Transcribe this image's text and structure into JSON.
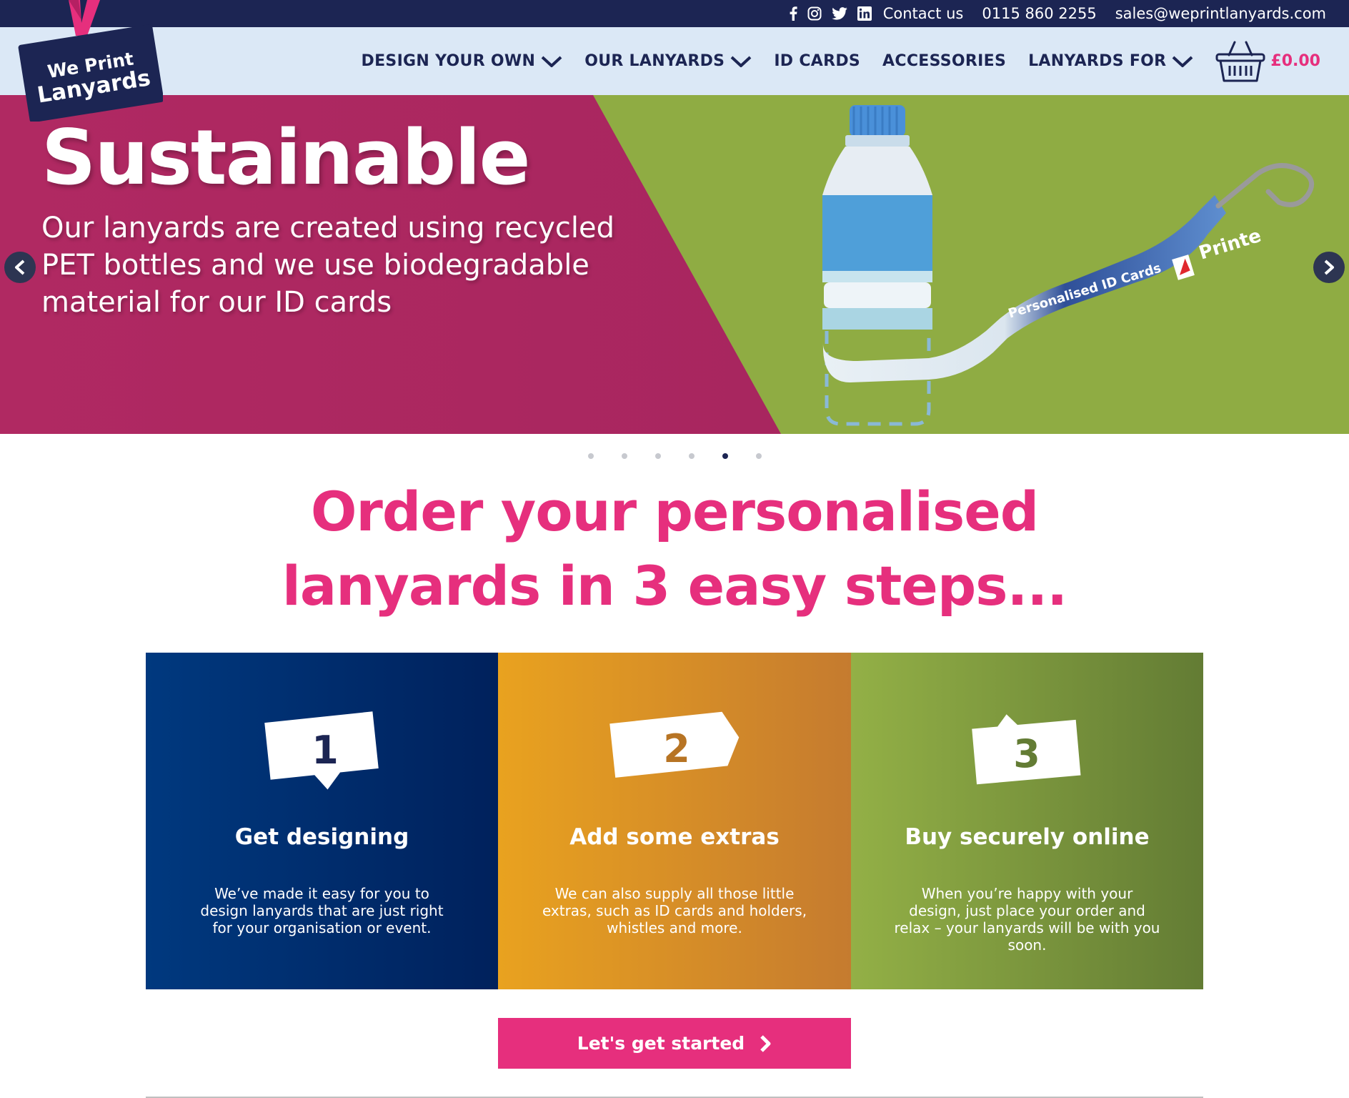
{
  "topbar": {
    "social": [
      "facebook-icon",
      "instagram-icon",
      "twitter-icon",
      "linkedin-icon"
    ],
    "contact_label": "Contact us",
    "phone": "0115 860 2255",
    "email": "sales@weprintlanyards.com"
  },
  "logo": {
    "line1": "We Print",
    "line2": "Lanyards"
  },
  "nav": {
    "items": [
      {
        "label": "DESIGN YOUR OWN",
        "dropdown": true
      },
      {
        "label": "OUR LANYARDS",
        "dropdown": true
      },
      {
        "label": "ID CARDS",
        "dropdown": false
      },
      {
        "label": "ACCESSORIES",
        "dropdown": false
      },
      {
        "label": "LANYARDS FOR",
        "dropdown": true
      }
    ],
    "basket_total": "£0.00"
  },
  "hero": {
    "title": "Sustainable",
    "subtitle": "Our lanyards are created using recycled PET bottles and we use biodegradable material for our ID cards",
    "lanyard_text_1": "Personalised ID Cards",
    "lanyard_text_2": "Printe",
    "slide_count": 6,
    "active_slide": 5
  },
  "heading": {
    "line1": "Order your personalised",
    "line2": "lanyards in 3 easy steps..."
  },
  "steps": [
    {
      "number": "1",
      "title": "Get designing",
      "text": "We’ve made it easy for you to design lanyards that are just right for your organisation or event."
    },
    {
      "number": "2",
      "title": "Add some extras",
      "text": "We can also supply all those little extras, such as ID cards and holders, whistles and more."
    },
    {
      "number": "3",
      "title": "Buy securely online",
      "text": "When you’re happy with your design, just place your order and relax – your lanyards will be with you soon."
    }
  ],
  "cta": {
    "label": "Let's get started"
  },
  "colors": {
    "navy": "#1c2553",
    "pink": "#e62f7d",
    "header_bg": "#dbe8f6",
    "hero_magenta": "#b1285f",
    "hero_green": "#8fac43"
  }
}
